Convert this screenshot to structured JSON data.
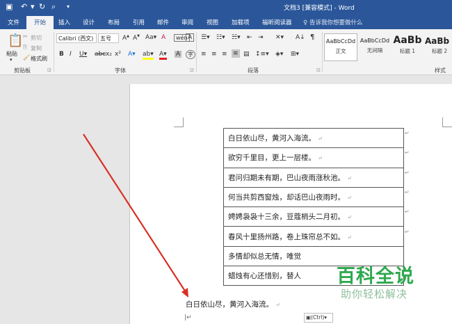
{
  "titlebar": {
    "title": "文档3 [兼容模式] - Word"
  },
  "tabs": [
    {
      "label": "文件"
    },
    {
      "label": "开始"
    },
    {
      "label": "插入"
    },
    {
      "label": "设计"
    },
    {
      "label": "布局"
    },
    {
      "label": "引用"
    },
    {
      "label": "邮件"
    },
    {
      "label": "审阅"
    },
    {
      "label": "视图"
    },
    {
      "label": "加载项"
    },
    {
      "label": "福昕阅读器"
    }
  ],
  "tell_me": "告诉我你想要做什么",
  "ribbon": {
    "clipboard": {
      "paste": "粘贴",
      "cut": "剪切",
      "copy": "复制",
      "format_painter": "格式刷",
      "group": "剪贴板"
    },
    "font": {
      "name": "Calibri (西文)",
      "size": "五号",
      "group": "字体"
    },
    "paragraph": {
      "group": "段落"
    },
    "styles": {
      "items": [
        {
          "preview": "AaBbCcDd",
          "name": "正文"
        },
        {
          "preview": "AaBbCcDd",
          "name": "无间隔"
        },
        {
          "preview": "AaBb",
          "name": "标题 1"
        },
        {
          "preview": "AaBb",
          "name": "标题 2"
        }
      ],
      "group": "样式"
    }
  },
  "table_rows": [
    "白日依山尽，黄河入海流。",
    "欲穷千里目，更上一层楼。",
    "君问归期未有期，巴山夜雨涨秋池。",
    "何当共剪西窗烛，却话巴山夜雨时。",
    "娉娉袅袅十三余，豆蔻梢头二月初。",
    "春风十里扬州路，卷上珠帘总不如。",
    "多情却似总无情，唯觉",
    "蜡烛有心还惜别，替人"
  ],
  "paragraph_text": "白日依山尽，黄河入海流。",
  "paste_options": "(Ctrl)",
  "watermark": {
    "title": "百科全说",
    "subtitle": "助你轻松解决"
  },
  "colors": {
    "word_blue": "#2b579a",
    "arrow": "#d93025",
    "watermark": "#2fa84f"
  }
}
